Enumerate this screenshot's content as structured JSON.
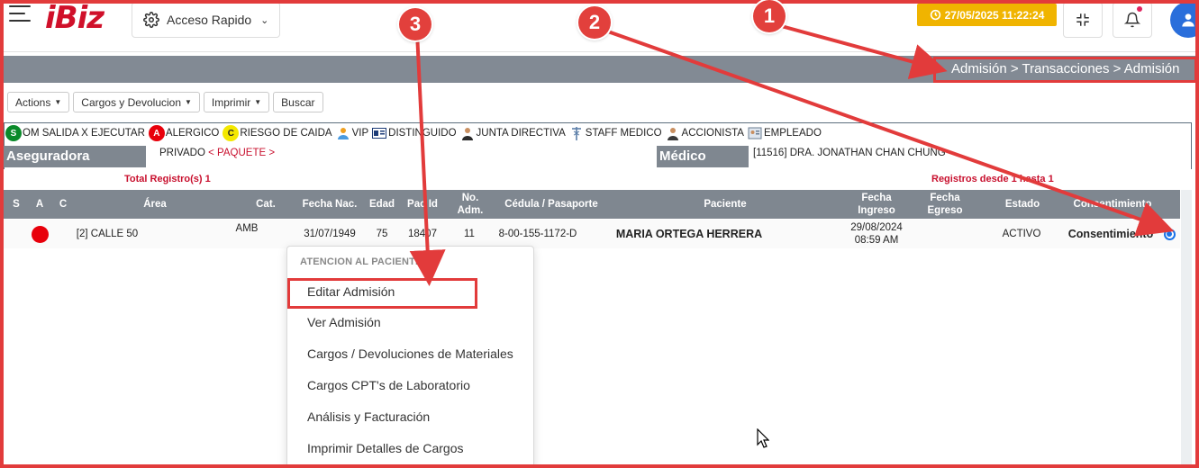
{
  "header": {
    "logo_text": "iBiz",
    "acceso_label": "Acceso Rapido",
    "datetime": "27/05/2025 11:22:24",
    "accent_color": "#d0102a"
  },
  "breadcrumb": "Admisión > Transacciones > Admisión",
  "toolbar": {
    "actions": "Actions",
    "cargos": "Cargos y Devolucion",
    "imprimir": "Imprimir",
    "buscar": "Buscar"
  },
  "legend": {
    "s_letter": "S",
    "s_label": "OM SALIDA X EJECUTAR",
    "a_letter": "A",
    "a_label": "ALERGICO",
    "c_letter": "C",
    "c_label": "RIESGO DE CAIDA",
    "vip": "VIP",
    "distinguido": "DISTINGUIDO",
    "junta": "JUNTA DIRECTIVA",
    "staff": "STAFF MEDICO",
    "accionista": "ACCIONISTA",
    "empleado": "EMPLEADO"
  },
  "info": {
    "aseguradora_label": "Aseguradora",
    "aseguradora_value": "PRIVADO",
    "paquete": "< PAQUETE >",
    "medico_label": "Médico",
    "medico_value": "[11516] DRA. JONATHAN CHAN CHUNG"
  },
  "summary": {
    "total": "Total Registro(s) 1",
    "range": "Registros desde 1 hasta 1"
  },
  "table": {
    "headers": {
      "s": "S",
      "a": "A",
      "c": "C",
      "area": "Área",
      "cat": "Cat.",
      "fecha_nac": "Fecha Nac.",
      "edad": "Edad",
      "pac_id": "Pac Id",
      "no_adm": "No. Adm.",
      "cedula": "Cédula / Pasaporte",
      "paciente": "Paciente",
      "fecha_ingreso": "Fecha Ingreso",
      "fecha_egreso": "Fecha Egreso",
      "estado": "Estado",
      "consentimiento": "Consentimiento"
    },
    "row": {
      "area": "[2] CALLE 50",
      "cat": "AMB",
      "fecha_nac": "31/07/1949",
      "edad": "75",
      "pac_id": "18407",
      "no_adm": "11",
      "cedula": "8-00-155-1172-D",
      "paciente": "MARIA ORTEGA HERRERA",
      "fecha_ingreso_date": "29/08/2024",
      "fecha_ingreso_time": "08:59 AM",
      "estado": "ACTIVO",
      "consentimiento": "Consentimiento"
    }
  },
  "context_menu": {
    "header": "ATENCION AL PACIENTE",
    "items": [
      "Editar Admisión",
      "Ver Admisión",
      "Cargos / Devoluciones de Materiales",
      "Cargos CPT's de Laboratorio",
      "Análisis y Facturación",
      "Imprimir Detalles de Cargos"
    ]
  },
  "annotations": {
    "n1": "1",
    "n2": "2",
    "n3": "3",
    "color": "#e23b3b"
  }
}
